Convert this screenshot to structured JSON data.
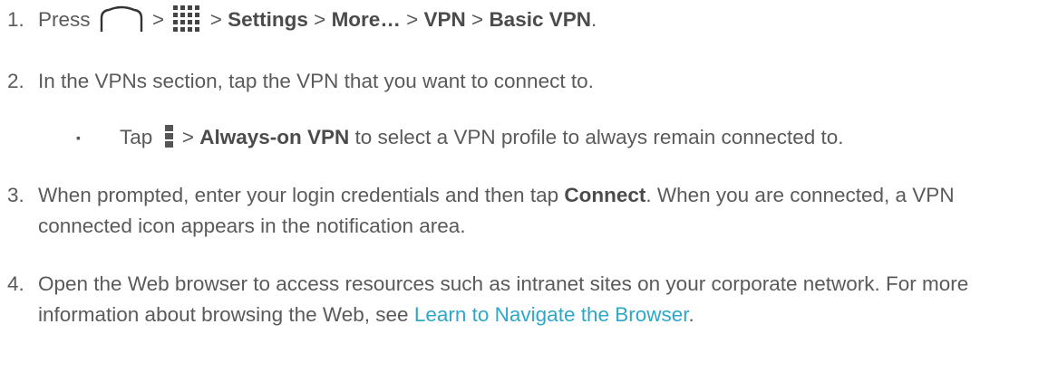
{
  "steps": [
    {
      "number": "1.",
      "press": "Press",
      "sep": ">",
      "settings": "Settings",
      "more": "More…",
      "vpn": "VPN",
      "basic_vpn": "Basic VPN",
      "end": "."
    },
    {
      "number": "2.",
      "text": "In the VPNs section, tap the VPN that you want to connect to."
    },
    {
      "bullet": "▪",
      "tap": "Tap",
      "sep": ">",
      "always_on": "Always-on VPN",
      "rest": "to select a VPN profile to always remain connected to."
    },
    {
      "number": "3.",
      "pre": "When prompted, enter your login credentials and then tap",
      "connect": "Connect",
      "post": ". When you are connected, a VPN connected icon appears in the notification area."
    },
    {
      "number": "4.",
      "pre": "Open the Web browser to access resources such as intranet sites on your corporate network. For more information about browsing the Web, see",
      "link": "Learn to Navigate the Browser",
      "end": "."
    }
  ],
  "icons": {
    "home": "home-icon",
    "apps": "apps-grid-icon",
    "menu": "menu-icon"
  },
  "colors": {
    "text": "#5a5a5a",
    "link": "#2ea7c8",
    "icon": "#333333"
  }
}
